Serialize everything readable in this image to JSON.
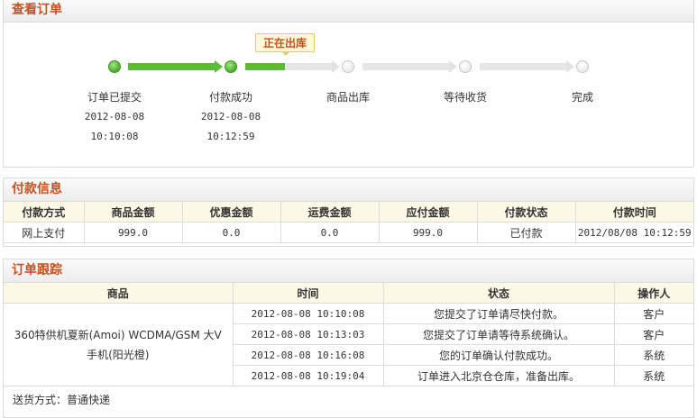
{
  "view_order": {
    "title": "查看订单",
    "current_badge": "正在出库",
    "steps": [
      {
        "label": "订单已提交",
        "date": "2012-08-08",
        "time": "10:10:08",
        "done": true
      },
      {
        "label": "付款成功",
        "date": "2012-08-08",
        "time": "10:12:59",
        "done": true
      },
      {
        "label": "商品出库",
        "date": "",
        "time": "",
        "done": false
      },
      {
        "label": "等待收货",
        "date": "",
        "time": "",
        "done": false
      },
      {
        "label": "完成",
        "date": "",
        "time": "",
        "done": false
      }
    ]
  },
  "payment": {
    "title": "付款信息",
    "headers": [
      "付款方式",
      "商品金额",
      "优惠金额",
      "运费金额",
      "应付金额",
      "付款状态",
      "付款时间"
    ],
    "row": [
      "网上支付",
      "999.0",
      "0.0",
      "0.0",
      "999.0",
      "已付款",
      "2012/08/08 10:12:59"
    ]
  },
  "tracking": {
    "title": "订单跟踪",
    "headers": [
      "商品",
      "时间",
      "状态",
      "操作人"
    ],
    "product": "360特供机夏新(Amoi) WCDMA/GSM 大V手机(阳光橙)",
    "rows": [
      {
        "time": "2012-08-08 10:10:08",
        "status": "您提交了订单请尽快付款。",
        "operator": "客户"
      },
      {
        "time": "2012-08-08 10:13:03",
        "status": "您提交了订单请等待系统确认。",
        "operator": "客户"
      },
      {
        "time": "2012-08-08 10:16:08",
        "status": "您的订单确认付款成功。",
        "operator": "系统"
      },
      {
        "time": "2012-08-08 10:19:04",
        "status": "订单进入北京仓仓库，准备出库。",
        "operator": "系统"
      }
    ],
    "shipping": "送货方式：普通快递"
  },
  "colors": {
    "accent": "#c8501e",
    "done": "#5cbc38"
  }
}
